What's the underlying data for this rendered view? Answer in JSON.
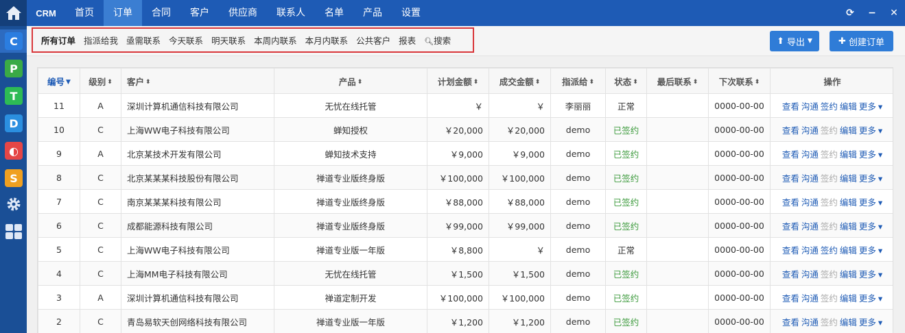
{
  "nav": {
    "brand": "CRM",
    "items": [
      "首页",
      "订单",
      "合同",
      "客户",
      "供应商",
      "联系人",
      "名单",
      "产品",
      "设置"
    ],
    "active_index": 1
  },
  "apps": [
    {
      "letter": "C",
      "color": "#2b7de0",
      "icon": "c-app-icon"
    },
    {
      "letter": "P",
      "color": "#3aaa46",
      "icon": "p-app-icon"
    },
    {
      "letter": "T",
      "color": "#2dbb55",
      "icon": "t-app-icon"
    },
    {
      "letter": "D",
      "color": "#2b8fe0",
      "icon": "d-app-icon"
    },
    {
      "letter": "◐",
      "color": "#e54646",
      "icon": "o-app-icon"
    },
    {
      "letter": "S",
      "color": "#f0a020",
      "icon": "s-app-icon"
    }
  ],
  "filters": [
    "所有订单",
    "指派给我",
    "亟需联系",
    "今天联系",
    "明天联系",
    "本周内联系",
    "本月内联系",
    "公共客户",
    "报表",
    "搜索"
  ],
  "buttons": {
    "export": "导出",
    "create": "创建订单"
  },
  "table": {
    "headers": [
      "编号",
      "级别",
      "客户",
      "产品",
      "计划金额",
      "成交金额",
      "指派给",
      "状态",
      "最后联系",
      "下次联系",
      "操作"
    ],
    "ops": [
      "查看",
      "沟通",
      "签约",
      "编辑",
      "更多"
    ],
    "rows": [
      {
        "id": "11",
        "level": "A",
        "customer": "深圳计算机通信科技有限公司",
        "product": "无忧在线托管",
        "plan": "￥",
        "deal": "￥",
        "assignee": "李丽丽",
        "status": "正常",
        "signed": false,
        "last": "",
        "next": "0000-00-00"
      },
      {
        "id": "10",
        "level": "C",
        "customer": "上海WW电子科技有限公司",
        "product": "蝉知授权",
        "plan": "￥20,000",
        "deal": "￥20,000",
        "assignee": "demo",
        "status": "已签约",
        "signed": true,
        "last": "",
        "next": "0000-00-00"
      },
      {
        "id": "9",
        "level": "A",
        "customer": "北京某技术开发有限公司",
        "product": "蝉知技术支持",
        "plan": "￥9,000",
        "deal": "￥9,000",
        "assignee": "demo",
        "status": "已签约",
        "signed": true,
        "last": "",
        "next": "0000-00-00"
      },
      {
        "id": "8",
        "level": "C",
        "customer": "北京某某某科技股份有限公司",
        "product": "禅道专业版终身版",
        "plan": "￥100,000",
        "deal": "￥100,000",
        "assignee": "demo",
        "status": "已签约",
        "signed": true,
        "last": "",
        "next": "0000-00-00"
      },
      {
        "id": "7",
        "level": "C",
        "customer": "南京某某某科技有限公司",
        "product": "禅道专业版终身版",
        "plan": "￥88,000",
        "deal": "￥88,000",
        "assignee": "demo",
        "status": "已签约",
        "signed": true,
        "last": "",
        "next": "0000-00-00"
      },
      {
        "id": "6",
        "level": "C",
        "customer": "成都能源科技有限公司",
        "product": "禅道专业版终身版",
        "plan": "￥99,000",
        "deal": "￥99,000",
        "assignee": "demo",
        "status": "已签约",
        "signed": true,
        "last": "",
        "next": "0000-00-00"
      },
      {
        "id": "5",
        "level": "C",
        "customer": "上海WW电子科技有限公司",
        "product": "禅道专业版一年版",
        "plan": "￥8,800",
        "deal": "￥",
        "assignee": "demo",
        "status": "正常",
        "signed": false,
        "last": "",
        "next": "0000-00-00"
      },
      {
        "id": "4",
        "level": "C",
        "customer": "上海MM电子科技有限公司",
        "product": "无忧在线托管",
        "plan": "￥1,500",
        "deal": "￥1,500",
        "assignee": "demo",
        "status": "已签约",
        "signed": true,
        "last": "",
        "next": "0000-00-00"
      },
      {
        "id": "3",
        "level": "A",
        "customer": "深圳计算机通信科技有限公司",
        "product": "禅道定制开发",
        "plan": "￥100,000",
        "deal": "￥100,000",
        "assignee": "demo",
        "status": "已签约",
        "signed": true,
        "last": "",
        "next": "0000-00-00"
      },
      {
        "id": "2",
        "level": "C",
        "customer": "青岛易软天创网络科技有限公司",
        "product": "禅道专业版一年版",
        "plan": "￥1,200",
        "deal": "￥1,200",
        "assignee": "demo",
        "status": "已签约",
        "signed": true,
        "last": "",
        "next": "0000-00-00"
      }
    ]
  }
}
